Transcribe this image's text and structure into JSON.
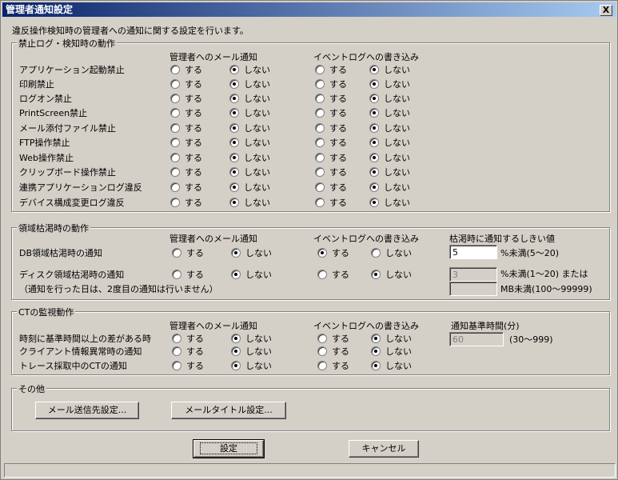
{
  "window": {
    "title": "管理者通知設定",
    "close_label": "X"
  },
  "description": "違反操作検知時の管理者への通知に関する設定を行います。",
  "col_mail": "管理者へのメール通知",
  "col_event": "イベントログへの書き込み",
  "opt_yes": "する",
  "opt_no": "しない",
  "section1": {
    "title": "禁止ログ・検知時の動作",
    "rows": [
      {
        "label": "アプリケーション起動禁止",
        "mail": "no",
        "event": "no"
      },
      {
        "label": "印刷禁止",
        "mail": "no",
        "event": "no"
      },
      {
        "label": "ログオン禁止",
        "mail": "no",
        "event": "no"
      },
      {
        "label": "PrintScreen禁止",
        "mail": "no",
        "event": "no"
      },
      {
        "label": "メール添付ファイル禁止",
        "mail": "no",
        "event": "no"
      },
      {
        "label": "FTP操作禁止",
        "mail": "no",
        "event": "no"
      },
      {
        "label": "Web操作禁止",
        "mail": "no",
        "event": "no"
      },
      {
        "label": "クリップボード操作禁止",
        "mail": "no",
        "event": "no"
      },
      {
        "label": "連携アプリケーションログ違反",
        "mail": "no",
        "event": "no"
      },
      {
        "label": "デバイス構成変更ログ違反",
        "mail": "no",
        "event": "no"
      }
    ]
  },
  "section2": {
    "title": "領域枯渇時の動作",
    "threshold_header": "枯渇時に通知するしきい値",
    "rows": [
      {
        "label": "DB領域枯渇時の通知",
        "mail": "no",
        "event": "yes"
      },
      {
        "label": "ディスク領域枯渇時の通知",
        "mail": "no",
        "event": "no"
      }
    ],
    "note": "（通知を行った日は、2度目の通知は行いません）",
    "db_threshold_value": "5",
    "db_threshold_unit": "%未満(5〜20)",
    "disk_pct_value": "3",
    "disk_pct_unit": "%未満(1〜20) または",
    "disk_mb_value": "",
    "disk_mb_unit": "MB未満(100〜99999)"
  },
  "section3": {
    "title": "CTの監視動作",
    "base_time_header": "通知基準時間(分)",
    "rows": [
      {
        "label": "時刻に基準時間以上の差がある時",
        "mail": "no",
        "event": "no"
      },
      {
        "label": "クライアント情報異常時の通知",
        "mail": "no",
        "event": "no"
      },
      {
        "label": "トレース採取中のCTの通知",
        "mail": "no",
        "event": "no"
      }
    ],
    "base_time_value": "60",
    "base_time_range": "(30〜999)"
  },
  "section4": {
    "title": "その他",
    "mail_dest_button": "メール送信先設定...",
    "mail_title_button": "メールタイトル設定..."
  },
  "footer": {
    "ok_button": "設定",
    "cancel_button": "キャンセル"
  }
}
